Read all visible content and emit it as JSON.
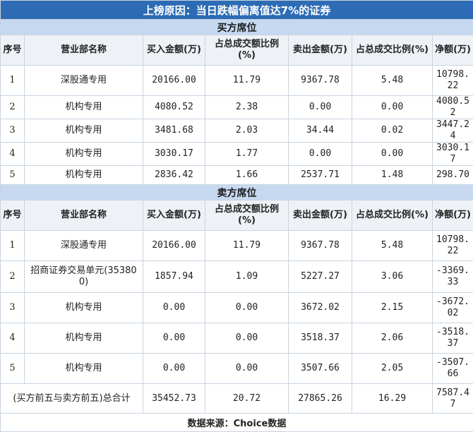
{
  "title": "上榜原因：当日跌幅偏离值达7%的证券",
  "buy_section": {
    "label": "买方席位",
    "headers": [
      "序号",
      "营业部名称",
      "买入金额(万)",
      "占总成交额比例(%)",
      "卖出金额(万)",
      "占总成交比例(%)",
      "净额(万)"
    ],
    "rows": [
      [
        "1",
        "深股通专用",
        "20166.00",
        "11.79",
        "9367.78",
        "5.48",
        "10798.22"
      ],
      [
        "2",
        "机构专用",
        "4080.52",
        "2.38",
        "0.00",
        "0.00",
        "4080.52"
      ],
      [
        "3",
        "机构专用",
        "3481.68",
        "2.03",
        "34.44",
        "0.02",
        "3447.24"
      ],
      [
        "4",
        "机构专用",
        "3030.17",
        "1.77",
        "0.00",
        "0.00",
        "3030.17"
      ],
      [
        "5",
        "机构专用",
        "2836.42",
        "1.66",
        "2537.71",
        "1.48",
        "298.70"
      ]
    ]
  },
  "sell_section": {
    "label": "卖方席位",
    "headers": [
      "序号",
      "营业部名称",
      "买入金额(万)",
      "占总成交额比例(%)",
      "卖出金额(万)",
      "占总成交比例(%)",
      "净额(万)"
    ],
    "rows": [
      [
        "1",
        "深股通专用",
        "20166.00",
        "11.79",
        "9367.78",
        "5.48",
        "10798.22"
      ],
      [
        "2",
        "招商证券交易单元(353800)",
        "1857.94",
        "1.09",
        "5227.27",
        "3.06",
        "-3369.33"
      ],
      [
        "3",
        "机构专用",
        "0.00",
        "0.00",
        "3672.02",
        "2.15",
        "-3672.02"
      ],
      [
        "4",
        "机构专用",
        "0.00",
        "0.00",
        "3518.37",
        "2.06",
        "-3518.37"
      ],
      [
        "5",
        "机构专用",
        "0.00",
        "0.00",
        "3507.66",
        "2.05",
        "-3507.66"
      ]
    ]
  },
  "total": {
    "label": "(买方前五与卖方前五)总合计",
    "values": [
      "35452.73",
      "20.72",
      "27865.26",
      "16.29",
      "7587.47"
    ]
  },
  "source": "数据来源：Choice数据"
}
